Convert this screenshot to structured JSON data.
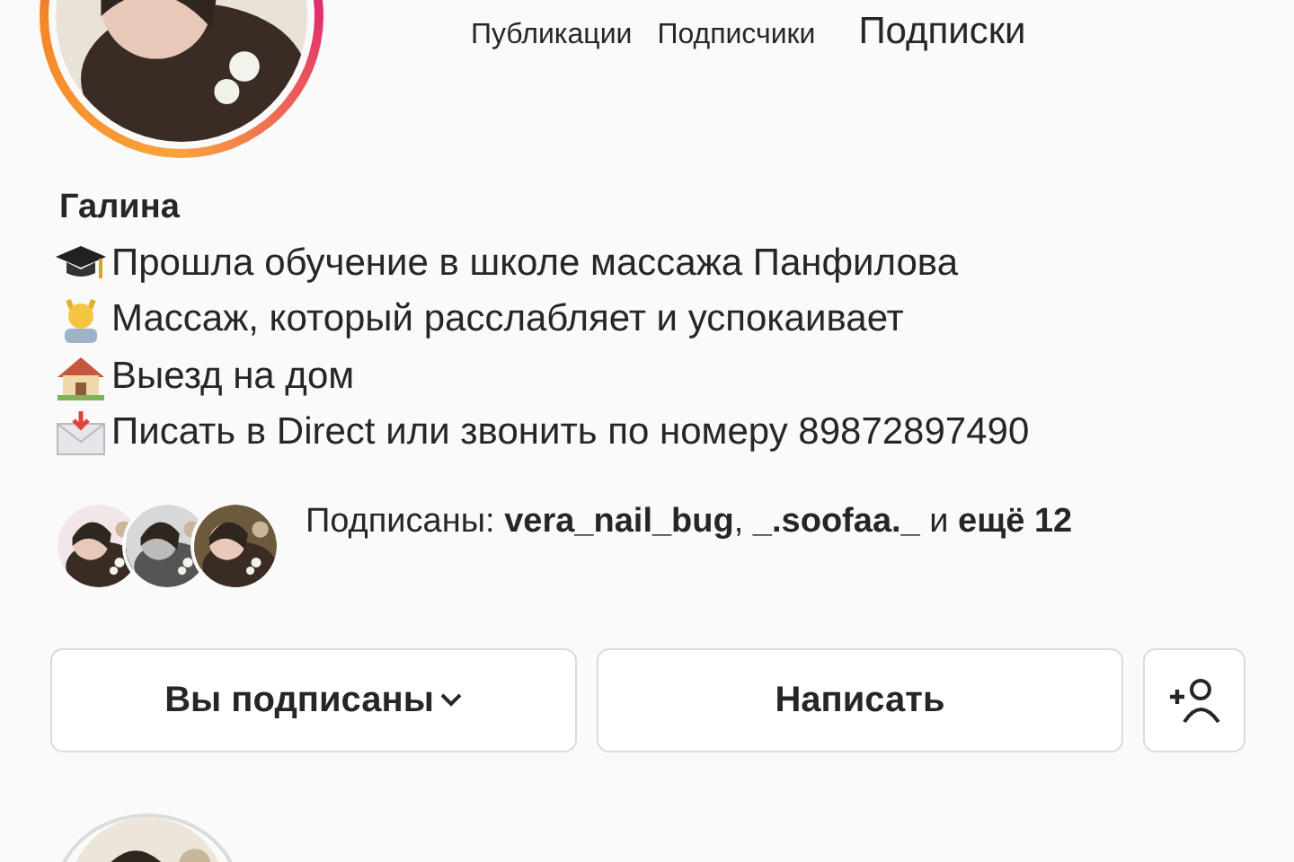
{
  "profile": {
    "stats": [
      "Публикации",
      "Подписчики",
      "Подписки"
    ],
    "name": "Галина",
    "bio": [
      {
        "kind": "cap",
        "text": "Прошла обучение в школе массажа Панфилова"
      },
      {
        "kind": "spa",
        "text": "Массаж, который расслабляет и успокаивает"
      },
      {
        "kind": "house",
        "text": "Выезд на дом"
      },
      {
        "kind": "mail",
        "text": "Писать в Direct или звонить по номеру 89872897490"
      }
    ],
    "followed_by": {
      "text": "Подписаны: **vera_nail_bug**, **_.soofaa._** и **ещё 12**"
    },
    "buttons": [
      {
        "kind": "dropdown",
        "label": "Вы подписаны"
      },
      {
        "kind": "plain",
        "label": "Написать"
      },
      {
        "kind": "add-person"
      }
    ]
  }
}
